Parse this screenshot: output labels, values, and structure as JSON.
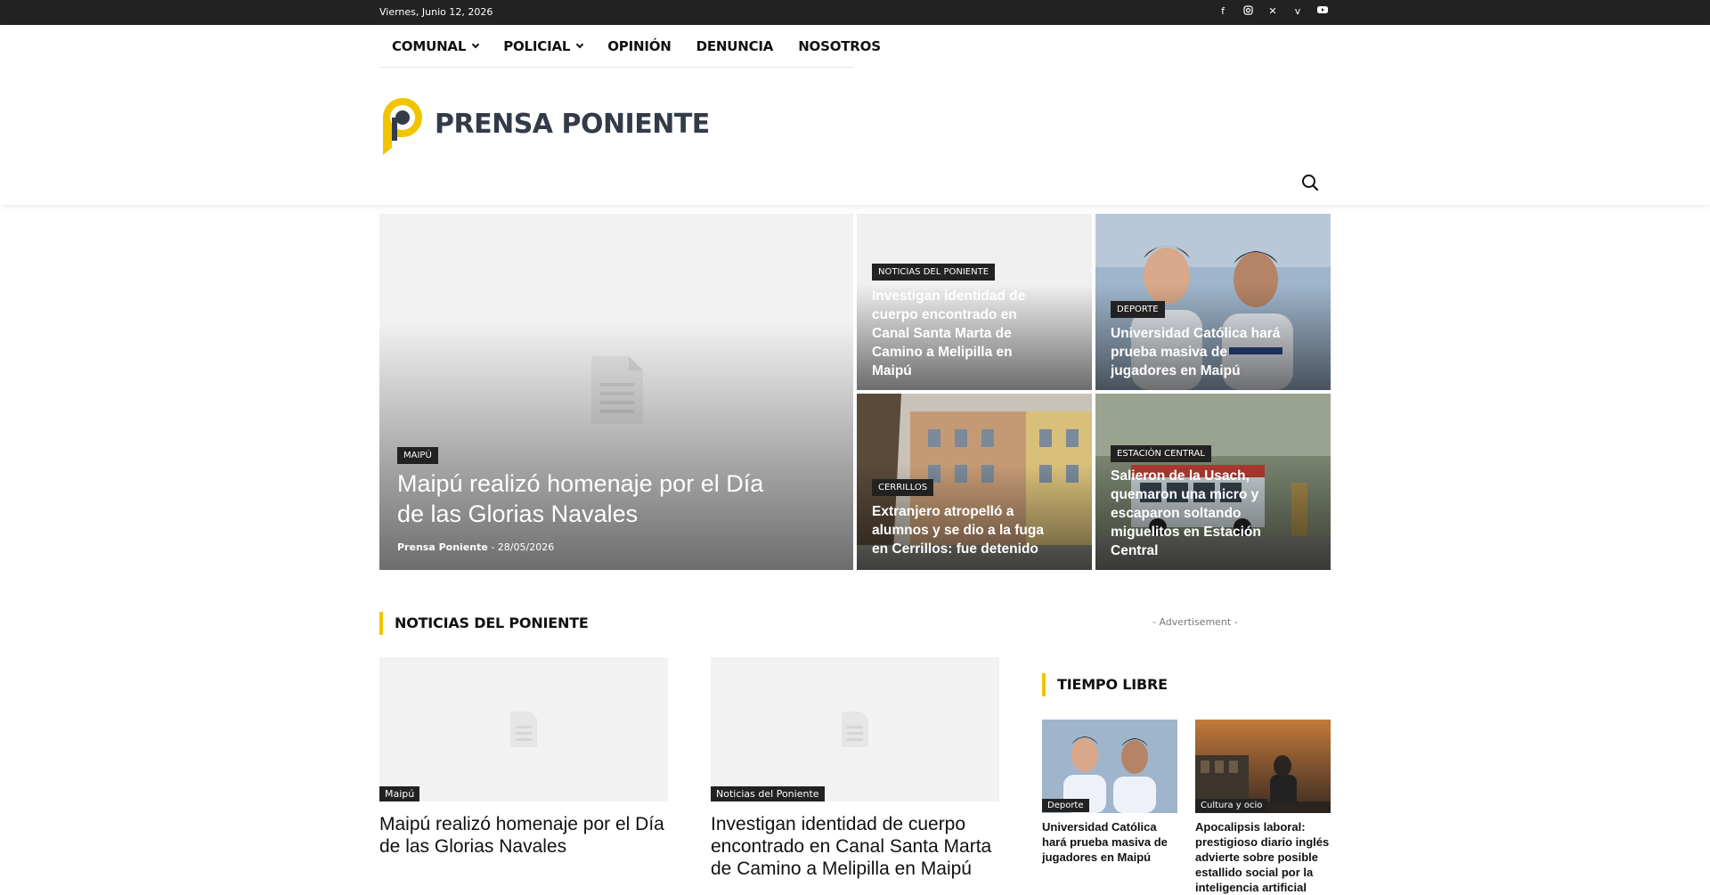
{
  "topbar": {
    "date": "Viernes, Junio 12, 2026",
    "socials": [
      "facebook-icon",
      "instagram-icon",
      "x-icon",
      "vimeo-icon",
      "youtube-icon"
    ]
  },
  "nav": {
    "items": [
      {
        "label": "COMUNAL",
        "dropdown": true
      },
      {
        "label": " POLICIAL",
        "dropdown": true
      },
      {
        "label": "OPINIÓN",
        "dropdown": false
      },
      {
        "label": "DENUNCIA",
        "dropdown": false
      },
      {
        "label": "NOSOTROS",
        "dropdown": false
      }
    ]
  },
  "logo": {
    "text": "PRENSA PONIENTE",
    "accent": "#f2c400",
    "text_color": "#333b49"
  },
  "hero": {
    "main": {
      "category": "MAIPÚ",
      "title": "Maipú realizó homenaje por el Día de las Glorias Navales",
      "author": "Prensa Poniente",
      "separator": "-",
      "date": "28/05/2026"
    },
    "tiles": [
      {
        "category": "NOTICIAS DEL PONIENTE",
        "title": "Investigan identidad de cuerpo encontrado en Canal Santa Marta de Camino a Melipilla en Maipú"
      },
      {
        "category": "DEPORTE",
        "title": "Universidad Católica hará prueba masiva de jugadores en Maipú"
      },
      {
        "category": "CERRILLOS",
        "title": "Extranjero atropelló a alumnos y se dio a la fuga en Cerrillos: fue detenido"
      },
      {
        "category": "ESTACIÓN CENTRAL",
        "title": "Salieron de la Usach, quemaron una micro y escaparon soltando miguelitos en Estación Central"
      }
    ]
  },
  "section_news": {
    "heading": "NOTICIAS DEL PONIENTE",
    "cards": [
      {
        "category": "Maipú",
        "title": "Maipú realizó homenaje por el Día de las Glorias Navales"
      },
      {
        "category": "Noticias del Poniente",
        "title": "Investigan identidad de cuerpo encontrado en Canal Santa Marta de Camino a Melipilla en Maipú"
      }
    ]
  },
  "sidebar": {
    "ad_label": "- Advertisement -",
    "heading": "TIEMPO LIBRE",
    "cards": [
      {
        "category": "Deporte",
        "title": "Universidad Católica hará prueba masiva de jugadores en Maipú"
      },
      {
        "category": "Cultura y ocio",
        "title": "Apocalipsis laboral: prestigioso diario inglés advierte sobre posible estallido social por la inteligencia artificial"
      }
    ]
  }
}
